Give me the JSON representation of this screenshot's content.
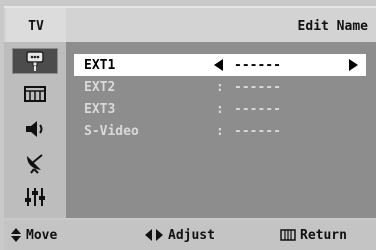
{
  "header": {
    "menu_label": "TV",
    "title": "Edit Name"
  },
  "sidebar": {
    "icons": [
      {
        "name": "input-icon",
        "active": true
      },
      {
        "name": "picture-icon",
        "active": false
      },
      {
        "name": "sound-icon",
        "active": false
      },
      {
        "name": "channel-icon",
        "active": false
      },
      {
        "name": "setup-icon",
        "active": false
      }
    ]
  },
  "rows": [
    {
      "label": "EXT1",
      "separator": "",
      "value": "------",
      "selected": true
    },
    {
      "label": "EXT2",
      "separator": ":",
      "value": "------",
      "selected": false
    },
    {
      "label": "EXT3",
      "separator": ":",
      "value": "------",
      "selected": false
    },
    {
      "label": "S-Video",
      "separator": ":",
      "value": "------",
      "selected": false
    }
  ],
  "footer": {
    "move_label": "Move",
    "adjust_label": "Adjust",
    "return_label": "Return"
  },
  "colors": {
    "panel": "#8d8d8d",
    "selected_row": "#ffffff",
    "dim_text": "#d9d9d9",
    "header": "#d3d3d3"
  }
}
